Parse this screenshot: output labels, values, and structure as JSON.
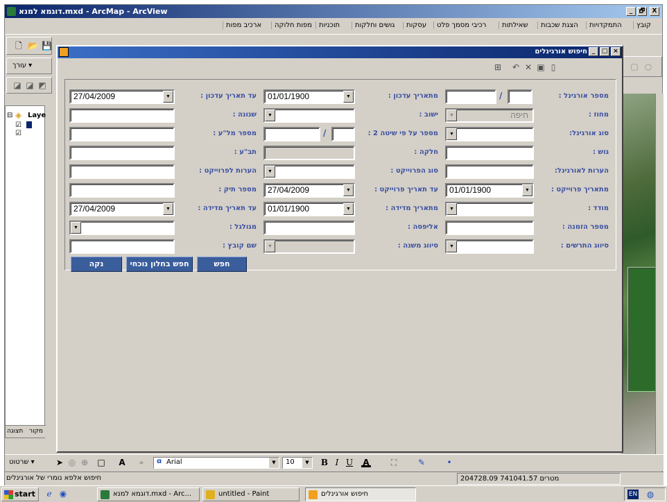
{
  "window": {
    "title": "דוגמא למנא.mxd - ArcMap - ArcView",
    "min": "_",
    "max": "🗗",
    "close": "X"
  },
  "menu": {
    "items": [
      "קובץ",
      "התמקדויות",
      "הצגת שכבות",
      "שאילתות",
      "רכיבי מסמך פלט",
      "עסקות",
      "גושים וחלקות",
      "תוכניות",
      "מפות חלוקה",
      "ארכיב מפות"
    ]
  },
  "left_toolbar": {
    "editor_label": "עורך ▾"
  },
  "toc": {
    "layers_label": "Laye",
    "tabs": [
      "תצוגה",
      "מקור"
    ]
  },
  "dialog": {
    "title": "חיפוש אורגינלים",
    "fields": {
      "orig_no_label": "מספר אורגינל :",
      "orig_no_value": "",
      "orig_no_slash": "/",
      "from_update_label": "מתאריך עדכון :",
      "from_update_value": "01/01/1900",
      "to_update_label": "עד תאריך עדכון :",
      "to_update_value": "27/04/2009",
      "district_label": "מחוז :",
      "district_value": "חיפה",
      "settlement_label": "ישוב :",
      "settlement_value": "",
      "year_label": "שנונה :",
      "year_value": "",
      "orig_type_label": "סוג אורגינל:",
      "orig_type_value": "",
      "method2_label": "מספר על פי שיטה 2 :",
      "method2_slash": "/",
      "mal_label": "מספר מל\"ע :",
      "mal_value": "",
      "block_label": "גוש :",
      "block_value": "",
      "parcel_label": "חלקה :",
      "parcel_value": "",
      "tba_label": "תב\"ע :",
      "tba_value": "",
      "orig_notes_label": "הערות לאורגינל:",
      "orig_notes_value": "",
      "project_type_label": "סוג הפרוייקט :",
      "project_type_value": "",
      "project_notes_label": "הערות לפרוייקט :",
      "project_notes_value": "",
      "from_project_label": "מתאריך פרוייקט :",
      "from_project_value": "01/01/1900",
      "to_project_label": "עד תאריך פרוייקט :",
      "to_project_value": "27/04/2009",
      "file_no_label": "מספר תיק :",
      "file_no_value": "",
      "surveyor_label": "מודד :",
      "surveyor_value": "",
      "from_measure_label": "מתאריך מדידה :",
      "from_measure_value": "01/01/1900",
      "to_measure_label": "עד תאריך מדידה :",
      "to_measure_value": "27/04/2009",
      "order_no_label": "מספר הזמנה :",
      "order_no_value": "",
      "elipsa_label": "אליפסה :",
      "elipsa_value": "",
      "cylinder_label": "מגולגל :",
      "cylinder_value": "",
      "drawing_class_label": "סיווג התרשים :",
      "drawing_class_value": "",
      "sub_class_label": "סיווג משנה :",
      "sub_class_value": "",
      "file_name_label": "שם קובץ :",
      "file_name_value": ""
    },
    "buttons": {
      "search": "חפש",
      "search_current": "חפש בחלון נוכחי",
      "clear": "נקה"
    }
  },
  "drawbar": {
    "draw_label": "שרטוט ▾",
    "font_name": "Arial",
    "font_size": "10",
    "bold": "B",
    "italic": "I",
    "underline": "U"
  },
  "statusbar": {
    "left_text": "חיפוש אלפא נומרי של אורגינלים",
    "coords": "204728.09  741041.57 מטרים"
  },
  "taskbar": {
    "start": "start",
    "tasks": [
      "דוגמא למנא.mxd - Arc...",
      "untitled - Paint",
      "חיפוש אורגינלים"
    ],
    "lang": "EN"
  },
  "colors": {
    "title_blue": "#0a246a",
    "label_blue": "#3a4fa0",
    "button_blue": "#3a5d9c"
  }
}
